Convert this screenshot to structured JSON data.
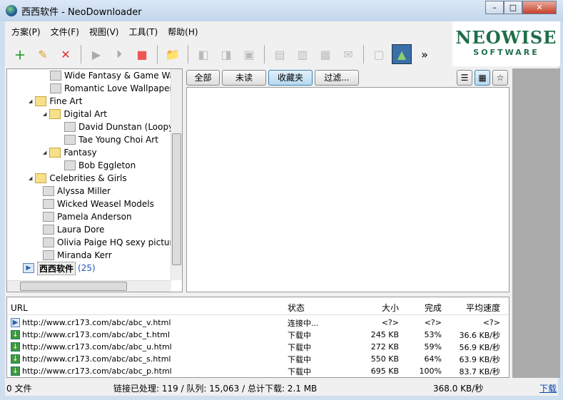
{
  "window": {
    "title": "西西软件 - NeoDownloader",
    "min": "–",
    "max": "□",
    "close": "✕"
  },
  "menu": [
    "方案(P)",
    "文件(F)",
    "视图(V)",
    "工具(T)",
    "帮助(H)"
  ],
  "toolbar": {
    "more": "»"
  },
  "logo": {
    "line1": "NEOWISE",
    "line2": "SOFTWARE"
  },
  "tree": [
    {
      "label": "Wide Fantasy & Game Wallp",
      "level": 3,
      "type": "page"
    },
    {
      "label": "Romantic Love Wallpapers",
      "level": 3,
      "type": "page"
    },
    {
      "label": "Fine Art",
      "level": 1,
      "type": "folder"
    },
    {
      "label": "Digital Art",
      "level": 2,
      "type": "folder"
    },
    {
      "label": "David Dunstan (Loopyda",
      "level": 3,
      "type": "page"
    },
    {
      "label": "Tae Young Choi Art",
      "level": 3,
      "type": "page"
    },
    {
      "label": "Fantasy",
      "level": 2,
      "type": "folder"
    },
    {
      "label": "Bob Eggleton",
      "level": 3,
      "type": "page"
    },
    {
      "label": "Celebrities & Girls",
      "level": 1,
      "type": "folder"
    },
    {
      "label": "Alyssa Miller",
      "level": 2,
      "type": "page"
    },
    {
      "label": "Wicked Weasel Models",
      "level": 2,
      "type": "page"
    },
    {
      "label": "Pamela Anderson",
      "level": 2,
      "type": "page"
    },
    {
      "label": "Laura Dore",
      "level": 2,
      "type": "page"
    },
    {
      "label": "Olivia Paige HQ sexy picture",
      "level": 2,
      "type": "page"
    },
    {
      "label": "Miranda Kerr",
      "level": 2,
      "type": "page"
    }
  ],
  "project": {
    "label": "西西软件",
    "count": "(25)"
  },
  "filters": {
    "tabs": [
      "全部",
      "未读",
      "收藏夹",
      "过滤..."
    ],
    "active": 2
  },
  "list": {
    "headers": [
      "URL",
      "状态",
      "大小",
      "完成",
      "平均速度"
    ],
    "rows": [
      {
        "url": "http://www.cr173.com/abc/abc_v.html",
        "status": "连接中...",
        "size": "<?>",
        "done": "<?>",
        "speed": "<?>",
        "icon": "play"
      },
      {
        "url": "http://www.cr173.com/abc/abc_t.html",
        "status": "下载中",
        "size": "245 KB",
        "done": "53%",
        "speed": "36.6 KB/秒",
        "icon": "download"
      },
      {
        "url": "http://www.cr173.com/abc/abc_u.html",
        "status": "下载中",
        "size": "272 KB",
        "done": "59%",
        "speed": "56.9 KB/秒",
        "icon": "download"
      },
      {
        "url": "http://www.cr173.com/abc/abc_s.html",
        "status": "下载中",
        "size": "550 KB",
        "done": "64%",
        "speed": "63.9 KB/秒",
        "icon": "download"
      },
      {
        "url": "http://www.cr173.com/abc/abc_p.html",
        "status": "下载中",
        "size": "695 KB",
        "done": "100%",
        "speed": "83.7 KB/秒",
        "icon": "download"
      }
    ]
  },
  "status": {
    "files": "0 文件",
    "links": "链接已处理: 119 / 队列: 15,063 / 总计下载: 2.1 MB",
    "speed": "368.0 KB/秒",
    "link": "下载"
  }
}
